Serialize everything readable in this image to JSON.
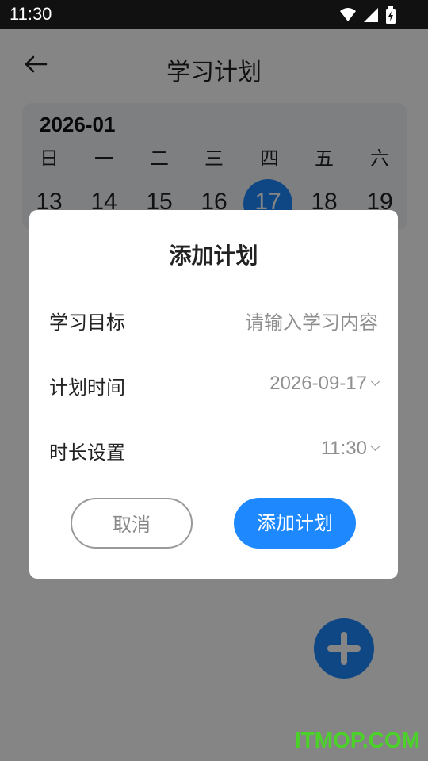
{
  "status_bar": {
    "time": "11:30"
  },
  "header": {
    "title": "学习计划"
  },
  "calendar": {
    "month": "2026-01",
    "weekdays": [
      "日",
      "一",
      "二",
      "三",
      "四",
      "五",
      "六"
    ],
    "days": [
      "13",
      "14",
      "15",
      "16",
      "17",
      "18",
      "19"
    ],
    "selected_day": "17"
  },
  "dialog": {
    "title": "添加计划",
    "rows": [
      {
        "label": "学习目标",
        "placeholder": "请输入学习内容"
      },
      {
        "label": "计划时间",
        "value": "2026-09-17"
      },
      {
        "label": "时长设置",
        "value": "11:30"
      }
    ],
    "cancel_label": "取消",
    "confirm_label": "添加计划"
  },
  "watermark": "ITMOP.COM",
  "colors": {
    "accent": "#1e88ff",
    "watermark": "#4cd02a"
  },
  "icons": [
    "wifi-icon",
    "signal-icon",
    "battery-icon",
    "back-arrow-icon",
    "add-icon",
    "chevron-down-icon"
  ]
}
